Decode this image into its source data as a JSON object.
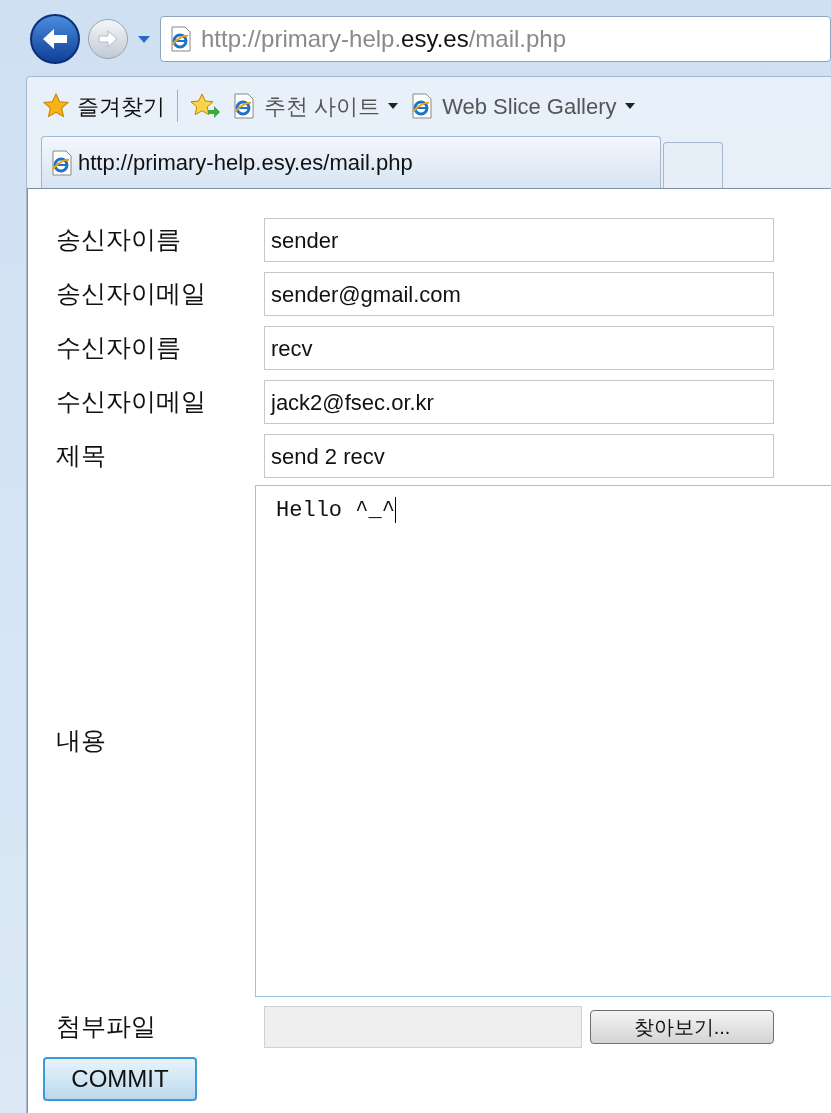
{
  "browser": {
    "address": {
      "prefix": "http://primary-help.",
      "domain": "esy.es",
      "suffix": "/mail.php"
    },
    "favorites_label": "즐겨찾기",
    "favorites_bar": [
      {
        "label": "추천 사이트",
        "has_menu": true
      },
      {
        "label": "Web Slice Gallery",
        "has_menu": true
      }
    ],
    "tabs": [
      {
        "label": "http://primary-help.esy.es/mail.php",
        "selected": true
      },
      {
        "selected": false
      }
    ]
  },
  "form": {
    "fields": [
      {
        "label": "송신자이름",
        "value": "sender"
      },
      {
        "label": "송신자이메일",
        "value": "sender@gmail.com"
      },
      {
        "label": "수신자이름",
        "value": "recv"
      },
      {
        "label": "수신자이메일",
        "value": "jack2@fsec.or.kr"
      },
      {
        "label": "제목",
        "value": "send 2 recv"
      }
    ],
    "body": {
      "label": "내용",
      "value": "Hello ^_^"
    },
    "attachment": {
      "label": "첨부파일",
      "browse_button": "찾아보기..."
    },
    "submit": "COMMIT"
  }
}
